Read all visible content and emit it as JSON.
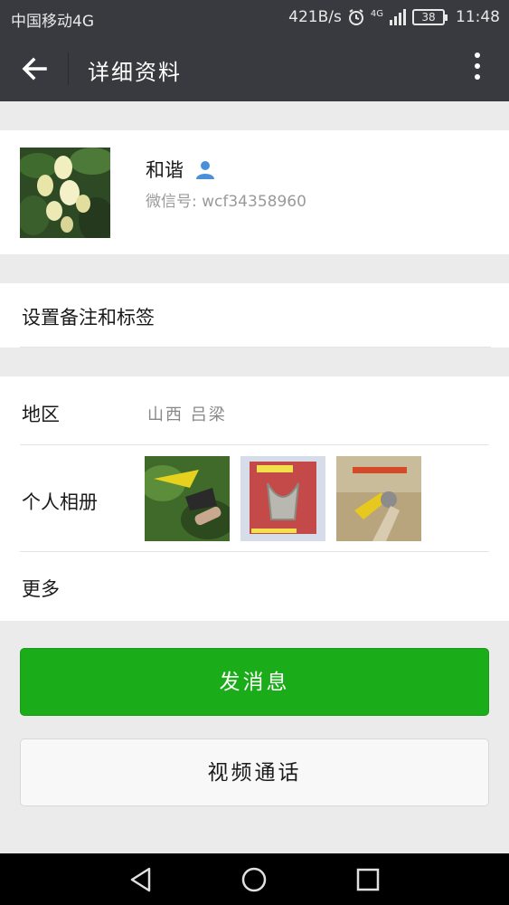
{
  "status_bar": {
    "carrier": "中国移动4G",
    "speed": "421B/s",
    "network": "4G",
    "battery": "38",
    "time": "11:48"
  },
  "header": {
    "title": "详细资料",
    "back_icon": "arrow-left-icon",
    "menu_icon": "more-vertical-icon"
  },
  "profile": {
    "name": "和谐",
    "wechat_id": "微信号: wcf34358960",
    "contact_icon": "person-icon"
  },
  "remark": {
    "label": "设置备注和标签"
  },
  "info": {
    "region_label": "地区",
    "region_value": "山西  吕梁",
    "album_label": "个人相册",
    "more_label": "更多"
  },
  "actions": {
    "send_message": "发消息",
    "video_call": "视频通话"
  },
  "colors": {
    "bar": "#393a3f",
    "primary": "#1aad19",
    "background": "#ebebeb"
  }
}
